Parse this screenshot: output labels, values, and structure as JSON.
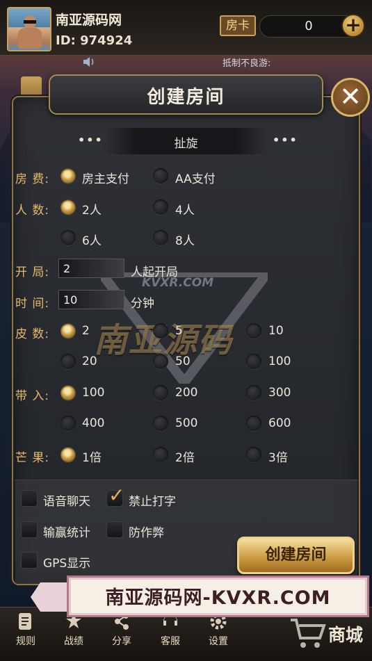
{
  "header": {
    "username": "南亚源码网",
    "user_id": "ID: 974924",
    "card_label": "房卡",
    "card_count": "0",
    "add_label": "+",
    "marquee": "抵制不良游:"
  },
  "dialog": {
    "title": "创建房间",
    "close_label": "✕",
    "game_type": "扯旋",
    "dots_left": "•••",
    "dots_right": "•••",
    "rows": {
      "fee": {
        "label": "房 费:",
        "options": [
          "房主支付",
          "AA支付"
        ],
        "selected": 0
      },
      "players": {
        "label": "人 数:",
        "options": [
          "2人",
          "4人",
          "6人",
          "8人"
        ],
        "selected": 0
      },
      "start": {
        "label": "开 局:",
        "value": "2",
        "suffix": "人起开局"
      },
      "time": {
        "label": "时 间:",
        "value": "10",
        "suffix": "分钟"
      },
      "skin": {
        "label": "皮 数:",
        "options": [
          "2",
          "5",
          "10",
          "20",
          "50",
          "100"
        ],
        "selected": 0
      },
      "buyin": {
        "label": "带 入:",
        "options": [
          "100",
          "200",
          "300",
          "400",
          "500",
          "600"
        ],
        "selected": 0
      },
      "mango": {
        "label": "芒 果:",
        "options": [
          "1倍",
          "2倍",
          "3倍"
        ],
        "selected": 0
      }
    },
    "checkboxes": [
      {
        "label": "语音聊天",
        "checked": false
      },
      {
        "label": "禁止打字",
        "checked": true
      },
      {
        "label": "输赢统计",
        "checked": false
      },
      {
        "label": "防作弊",
        "checked": false
      },
      {
        "label": "GPS显示",
        "checked": false
      }
    ],
    "create_button": "创建房间"
  },
  "watermark": {
    "url": "KVXR.COM",
    "text": "南亚源码"
  },
  "banner": {
    "text": "南亚源码网-KVXR.COM"
  },
  "bottom_nav": {
    "items": [
      {
        "label": "规则",
        "icon": "rules-icon"
      },
      {
        "label": "战绩",
        "icon": "trophy-icon"
      },
      {
        "label": "分享",
        "icon": "share-icon"
      },
      {
        "label": "客服",
        "icon": "support-icon"
      },
      {
        "label": "设置",
        "icon": "settings-icon"
      }
    ],
    "shop_label": "商城"
  }
}
